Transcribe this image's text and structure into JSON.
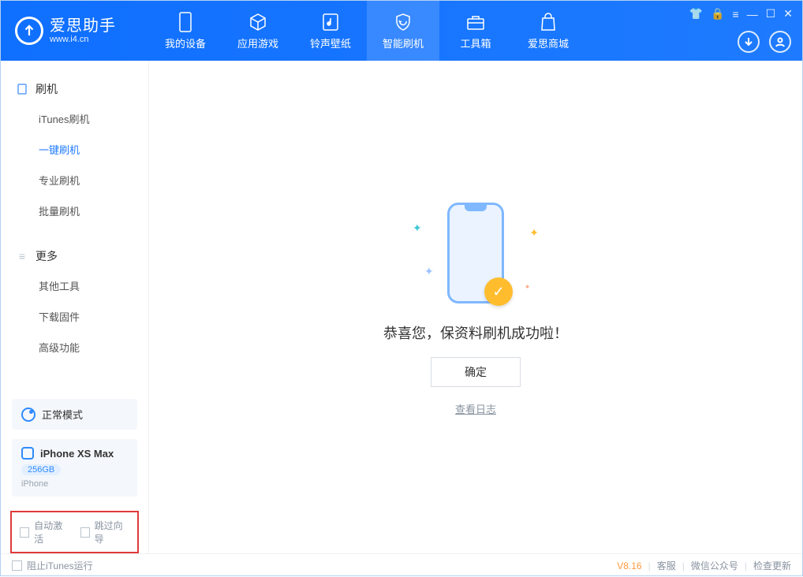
{
  "app": {
    "name": "爱思助手",
    "url": "www.i4.cn"
  },
  "tabs": [
    {
      "label": "我的设备"
    },
    {
      "label": "应用游戏"
    },
    {
      "label": "铃声壁纸"
    },
    {
      "label": "智能刷机"
    },
    {
      "label": "工具箱"
    },
    {
      "label": "爱思商城"
    }
  ],
  "sidebar": {
    "cat1": "刷机",
    "items1": [
      "iTunes刷机",
      "一键刷机",
      "专业刷机",
      "批量刷机"
    ],
    "cat2": "更多",
    "items2": [
      "其他工具",
      "下载固件",
      "高级功能"
    ]
  },
  "mode": {
    "label": "正常模式"
  },
  "device": {
    "name": "iPhone XS Max",
    "capacity": "256GB",
    "type": "iPhone"
  },
  "checks": {
    "auto_activate": "自动激活",
    "skip_guide": "跳过向导"
  },
  "main": {
    "success": "恭喜您，保资料刷机成功啦！",
    "ok": "确定",
    "view_log": "查看日志"
  },
  "footer": {
    "block_itunes": "阻止iTunes运行",
    "version": "V8.16",
    "links": [
      "客服",
      "微信公众号",
      "检查更新"
    ]
  }
}
